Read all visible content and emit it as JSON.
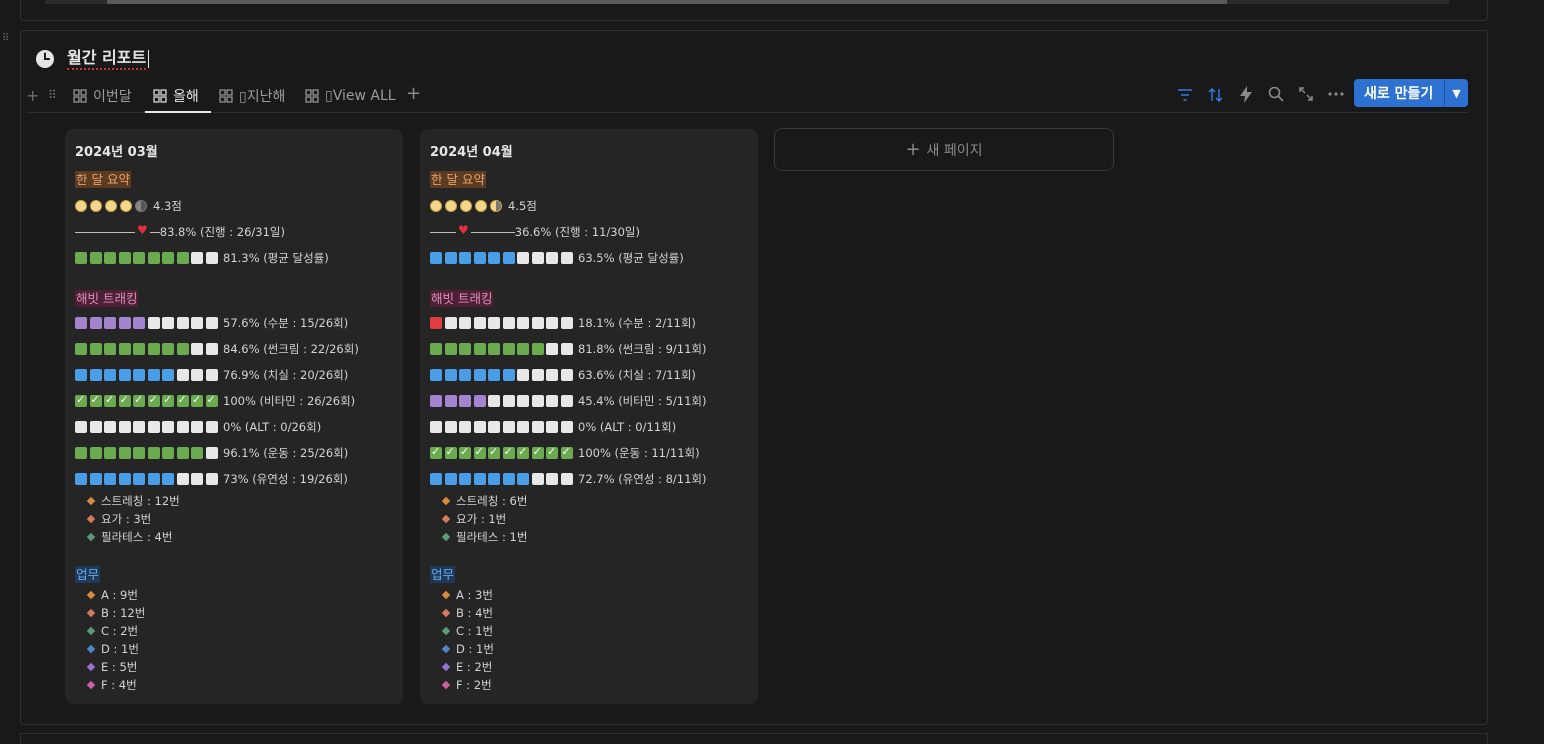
{
  "page": {
    "title": "월간 리포트"
  },
  "tabs": [
    {
      "label": "이번달"
    },
    {
      "label": "올해"
    },
    {
      "label": "▯지난해"
    },
    {
      "label": "▯View ALL"
    }
  ],
  "toolbar": {
    "new_button_label": "새로 만들기"
  },
  "new_page_label": "새 페이지",
  "cards": [
    {
      "title": "2024년 03월",
      "summary_tag": "한 달 요약",
      "score": "4.3점",
      "progress": "83.8% (진행 : 26/31일)",
      "progress_fraction": 0.838,
      "avg": "81.3% (평균 달성률)",
      "habit_tag": "해빗 트래킹",
      "habits": [
        {
          "text": "57.6% (수분 : 15/26회)",
          "squares": "pppppwwwww"
        },
        {
          "text": "84.6% (썬크림 : 22/26회)",
          "squares": "ggggggggww"
        },
        {
          "text": "76.9% (치실 : 20/26회)",
          "squares": "bbbbbbbwww"
        },
        {
          "text": "100% (비타민 : 26/26회)",
          "squares": "cccccccccc"
        },
        {
          "text": "0% (ALT : 0/26회)",
          "squares": "wwwwwwwwww"
        },
        {
          "text": "96.1% (운동 : 25/26회)",
          "squares": "gggggggggw"
        },
        {
          "text": "73% (유연성 : 19/26회)",
          "squares": "bbbbbbbwww"
        }
      ],
      "flex_items": [
        "스트레칭 : 12번",
        "요가 : 3번",
        "필라테스 : 4번"
      ],
      "work_tag": "업무",
      "work_items": [
        "A : 9번",
        "B : 12번",
        "C : 2번",
        "D : 1번",
        "E : 5번",
        "F : 4번"
      ]
    },
    {
      "title": "2024년 04월",
      "summary_tag": "한 달 요약",
      "score": "4.5점",
      "progress": "36.6% (진행 : 11/30일)",
      "progress_fraction": 0.366,
      "avg": "63.5% (평균 달성률)",
      "habit_tag": "해빗 트래킹",
      "habits": [
        {
          "text": "18.1% (수분 : 2/11회)",
          "squares": "rwwwwwwwww"
        },
        {
          "text": "81.8% (썬크림 : 9/11회)",
          "squares": "ggggggggww"
        },
        {
          "text": "63.6% (치실 : 7/11회)",
          "squares": "bbbbbbwwww"
        },
        {
          "text": "45.4% (비타민 : 5/11회)",
          "squares": "ppppwwwwww"
        },
        {
          "text": "0% (ALT : 0/11회)",
          "squares": "wwwwwwwwww"
        },
        {
          "text": "100% (운동 : 11/11회)",
          "squares": "cccccccccc"
        },
        {
          "text": "72.7% (유연성 : 8/11회)",
          "squares": "bbbbbbbwww"
        }
      ],
      "flex_items": [
        "스트레칭 : 6번",
        "요가 : 1번",
        "필라테스 : 1번"
      ],
      "work_tag": "업무",
      "work_items": [
        "A : 3번",
        "B : 4번",
        "C : 1번",
        "D : 1번",
        "E : 2번",
        "F : 2번"
      ]
    }
  ]
}
